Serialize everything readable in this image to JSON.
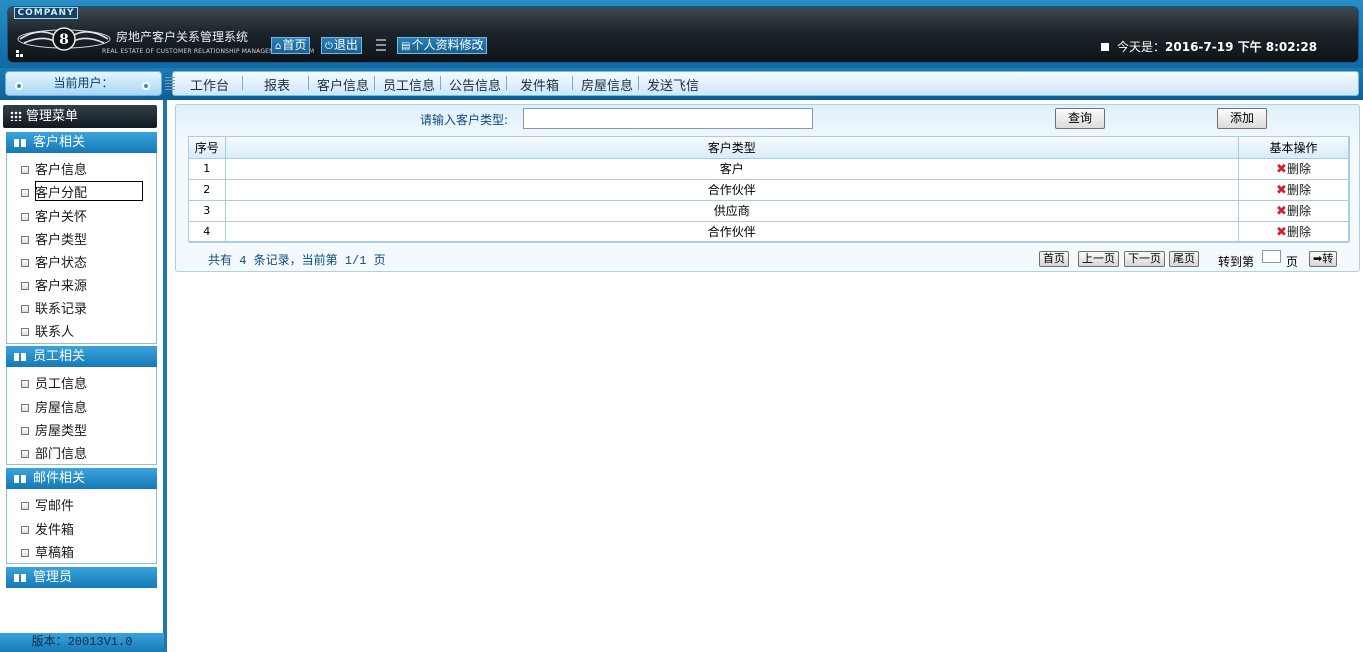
{
  "header": {
    "company_badge": "COMPANY",
    "system_name": "房地产客户关系管理系统",
    "system_name_en": "REAL ESTATE OF CUSTOMER RELATIONSHIP MANAGEMENT SYSTEM",
    "buttons": {
      "home": "首页",
      "logout": "退出",
      "profile": "个人资料修改"
    },
    "today_label": "今天是：",
    "today_value": "2016-7-19 下午 8:02:28"
  },
  "nav": {
    "current_user_label": "当前用户：",
    "items": [
      "工作台",
      "报表",
      "客户信息",
      "员工信息",
      "公告信息",
      "发件箱",
      "房屋信息",
      "发送飞信"
    ]
  },
  "sidebar": {
    "title": "管理菜单",
    "groups": [
      {
        "label": "客户相关",
        "items": [
          "客户信息",
          "客户分配",
          "客户关怀",
          "客户类型",
          "客户状态",
          "客户来源",
          "联系记录",
          "联系人"
        ]
      },
      {
        "label": "员工相关",
        "items": [
          "员工信息",
          "房屋信息",
          "房屋类型",
          "部门信息"
        ]
      },
      {
        "label": "邮件相关",
        "items": [
          "写邮件",
          "发件箱",
          "草稿箱"
        ]
      },
      {
        "label": "管理员",
        "items": []
      }
    ],
    "version": "版本：20013V1.0"
  },
  "query": {
    "label": "请输入客户类型:",
    "input_value": "",
    "search_button": "查询",
    "add_button": "添加"
  },
  "table": {
    "columns": [
      "序号",
      "客户类型",
      "基本操作"
    ],
    "rows": [
      {
        "no": "1",
        "type": "客户",
        "action": "删除"
      },
      {
        "no": "2",
        "type": "合作伙伴",
        "action": "删除"
      },
      {
        "no": "3",
        "type": "供应商",
        "action": "删除"
      },
      {
        "no": "4",
        "type": "合作伙伴",
        "action": "删除"
      }
    ]
  },
  "pager": {
    "summary": "共有 4 条记录，当前第 1/1 页",
    "first": "首页",
    "prev": "上一页",
    "next": "下一页",
    "last": "尾页",
    "goto_prefix": "转到第",
    "goto_suffix": "页",
    "goto_button": "转"
  },
  "colors": {
    "primary": "#1f77ad",
    "header_dark": "#1d252b",
    "delete_icon": "#d1202e"
  }
}
